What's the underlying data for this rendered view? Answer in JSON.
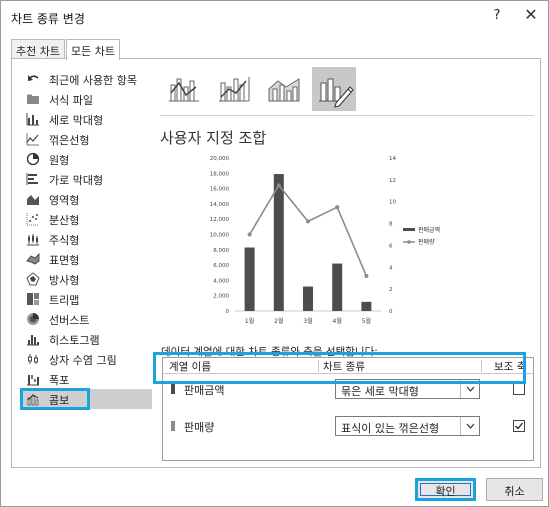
{
  "dialog": {
    "title": "차트 종류 변경",
    "help": "?",
    "close": "✕"
  },
  "tabs": [
    {
      "label": "추천 차트",
      "active": false
    },
    {
      "label": "모든 차트",
      "active": true
    }
  ],
  "sidebar": {
    "items": [
      {
        "label": "최근에 사용한 항목",
        "icon": "undo-icon"
      },
      {
        "label": "서식 파일",
        "icon": "folder-icon"
      },
      {
        "label": "세로 막대형",
        "icon": "column-chart-icon"
      },
      {
        "label": "꺾은선형",
        "icon": "line-chart-icon"
      },
      {
        "label": "원형",
        "icon": "pie-chart-icon"
      },
      {
        "label": "가로 막대형",
        "icon": "bar-chart-icon"
      },
      {
        "label": "영역형",
        "icon": "area-chart-icon"
      },
      {
        "label": "분산형",
        "icon": "scatter-chart-icon"
      },
      {
        "label": "주식형",
        "icon": "stock-chart-icon"
      },
      {
        "label": "표면형",
        "icon": "surface-chart-icon"
      },
      {
        "label": "방사형",
        "icon": "radar-chart-icon"
      },
      {
        "label": "트리맵",
        "icon": "treemap-icon"
      },
      {
        "label": "선버스트",
        "icon": "sunburst-icon"
      },
      {
        "label": "히스토그램",
        "icon": "histogram-icon"
      },
      {
        "label": "상자 수염 그림",
        "icon": "box-whisker-icon"
      },
      {
        "label": "폭포",
        "icon": "waterfall-icon"
      },
      {
        "label": "콤보",
        "icon": "combo-chart-icon",
        "selected": true
      }
    ]
  },
  "combo": {
    "title": "사용자 지정 조합",
    "subtypes": [
      "clustered-column-line-icon",
      "clustered-column-line-secondary-icon",
      "stacked-area-column-icon",
      "custom-combo-icon"
    ]
  },
  "chart_data": {
    "type": "bar",
    "categories": [
      "1월",
      "2월",
      "3월",
      "4월",
      "5월"
    ],
    "series": [
      {
        "name": "판매금액",
        "type": "bar",
        "axis": "primary",
        "values": [
          8300,
          17900,
          3200,
          6200,
          1200
        ]
      },
      {
        "name": "판매량",
        "type": "line",
        "axis": "secondary",
        "values": [
          7,
          11.5,
          8.2,
          9.5,
          3.2
        ]
      }
    ],
    "ylim": [
      0,
      20000
    ],
    "yticks": [
      "0",
      "2,000",
      "4,000",
      "6,000",
      "8,000",
      "10,000",
      "12,000",
      "14,000",
      "16,000",
      "18,000",
      "20,000"
    ],
    "y2lim": [
      0,
      14
    ],
    "y2ticks": [
      "0",
      "2",
      "4",
      "6",
      "8",
      "10",
      "12",
      "14"
    ],
    "legend": "right",
    "bar_color": "#4d4d4d",
    "line_color": "#8c8c8c"
  },
  "series_table": {
    "caption": "데이터 계열에 대한 차트 종류와 축을 선택합니다:",
    "headers": {
      "name": "계열 이름",
      "type": "차트 종류",
      "axis": "보조 축"
    },
    "rows": [
      {
        "name": "판매금액",
        "type": "묶은 세로 막대형",
        "secondary": false,
        "color": "#4d4d4d"
      },
      {
        "name": "판매량",
        "type": "표식이 있는 꺾은선형",
        "secondary": true,
        "color": "#8c8c8c"
      }
    ]
  },
  "buttons": {
    "ok": "확인",
    "cancel": "취소"
  }
}
